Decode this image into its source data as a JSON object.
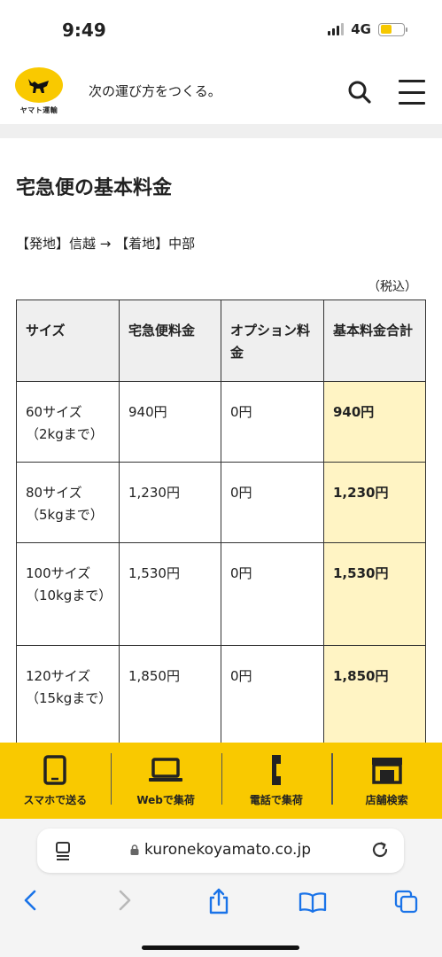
{
  "status_bar": {
    "time": "9:49",
    "network": "4G"
  },
  "header": {
    "logo_text": "ヤマト運輸",
    "tagline": "次の運び方をつくる。"
  },
  "main": {
    "title": "宅急便の基本料金",
    "route": "【発地】信越 → 【着地】中部",
    "tax_note": "（税込）",
    "table": {
      "headers": [
        "サイズ",
        "宅急便料金",
        "オプション料金",
        "基本料金合計"
      ],
      "rows": [
        {
          "size": "60サイズ",
          "weight": "（2kgまで）",
          "fee": "940円",
          "option": "0円",
          "total": "940円"
        },
        {
          "size": "80サイズ",
          "weight": "（5kgまで）",
          "fee": "1,230円",
          "option": "0円",
          "total": "1,230円"
        },
        {
          "size": "100サイズ",
          "weight": "（10kgまで）",
          "fee": "1,530円",
          "option": "0円",
          "total": "1,530円"
        },
        {
          "size": "120サイズ",
          "weight": "（15kgまで）",
          "fee": "1,850円",
          "option": "0円",
          "total": "1,850円"
        }
      ]
    }
  },
  "bottom_nav": {
    "items": [
      {
        "label": "スマホで送る",
        "icon": "smartphone-icon"
      },
      {
        "label": "Webで集荷",
        "icon": "laptop-icon"
      },
      {
        "label": "電話で集荷",
        "icon": "phone-icon"
      },
      {
        "label": "店舗検索",
        "icon": "store-icon"
      }
    ]
  },
  "browser": {
    "url": "kuronekoyamato.co.jp"
  },
  "colors": {
    "brand_yellow": "#f9c900",
    "total_highlight": "#fff4c4",
    "header_gray": "#efefef"
  }
}
